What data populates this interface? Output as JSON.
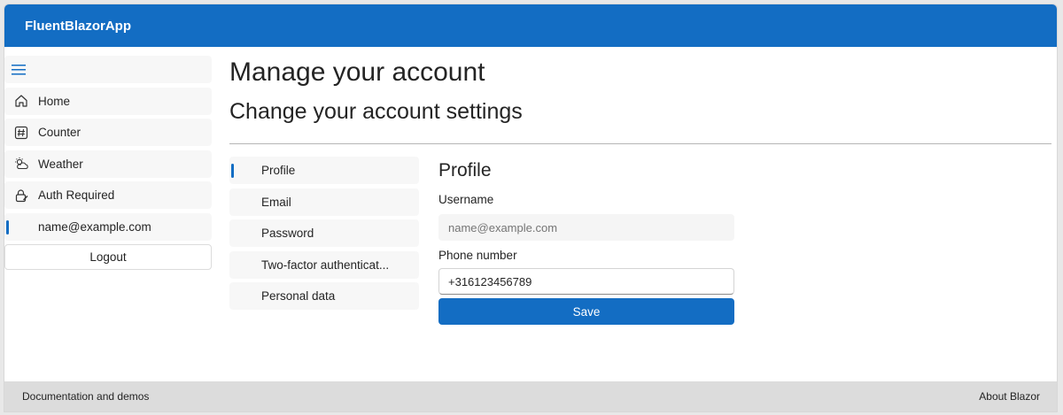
{
  "header": {
    "title": "FluentBlazorApp"
  },
  "nav": {
    "items": [
      {
        "label": "Home",
        "icon": "home-icon"
      },
      {
        "label": "Counter",
        "icon": "counter-icon"
      },
      {
        "label": "Weather",
        "icon": "weather-icon"
      },
      {
        "label": "Auth Required",
        "icon": "lock-icon"
      },
      {
        "label": "name@example.com",
        "active": true
      }
    ],
    "logout_label": "Logout"
  },
  "main": {
    "title": "Manage your account",
    "subtitle": "Change your account settings"
  },
  "subnav": {
    "items": [
      {
        "label": "Profile",
        "active": true
      },
      {
        "label": "Email"
      },
      {
        "label": "Password"
      },
      {
        "label": "Two-factor authenticat..."
      },
      {
        "label": "Personal data"
      }
    ]
  },
  "form": {
    "title": "Profile",
    "username_label": "Username",
    "username_placeholder": "name@example.com",
    "phone_label": "Phone number",
    "phone_value": "+316123456789",
    "save_label": "Save"
  },
  "footer": {
    "left": "Documentation and demos",
    "right": "About Blazor"
  },
  "colors": {
    "accent": "#136dc3",
    "footer": "#dcdcdc"
  }
}
